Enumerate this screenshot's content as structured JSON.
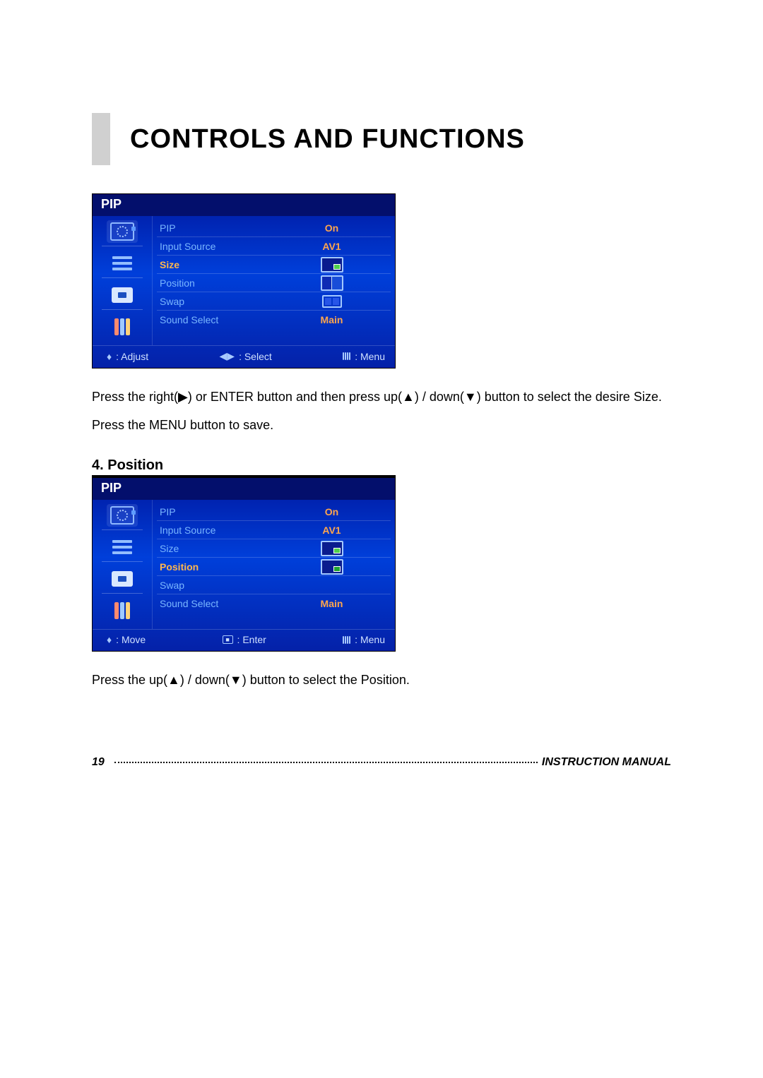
{
  "title": "CONTROLS AND FUNCTIONS",
  "osd1": {
    "header": "PIP",
    "rows": {
      "pip": {
        "label": "PIP",
        "value": "On"
      },
      "input_source": {
        "label": "Input Source",
        "value": "AV1"
      },
      "size": {
        "label": "Size",
        "value": ""
      },
      "position": {
        "label": "Position",
        "value": ""
      },
      "swap": {
        "label": "Swap",
        "value": ""
      },
      "sound_select": {
        "label": "Sound Select",
        "value": "Main"
      }
    },
    "foot": {
      "a": "Adjust",
      "b": "Select",
      "c": "Menu"
    }
  },
  "text1a": "Press the right(▶) or ENTER button and then press up(▲) / down(▼) button to select the desire Size.",
  "text1b": "Press the MENU button to save.",
  "section": "4. Position",
  "osd2": {
    "header": "PIP",
    "rows": {
      "pip": {
        "label": "PIP",
        "value": "On"
      },
      "input_source": {
        "label": "Input Source",
        "value": "AV1"
      },
      "size": {
        "label": "Size",
        "value": ""
      },
      "position": {
        "label": "Position",
        "value": ""
      },
      "swap": {
        "label": "Swap",
        "value": ""
      },
      "sound_select": {
        "label": "Sound Select",
        "value": "Main"
      }
    },
    "foot": {
      "a": "Move",
      "b": "Enter",
      "c": "Menu"
    }
  },
  "text2": "Press the up(▲) / down(▼) button to select the Position.",
  "footer": {
    "page": "19",
    "label": "INSTRUCTION MANUAL"
  }
}
